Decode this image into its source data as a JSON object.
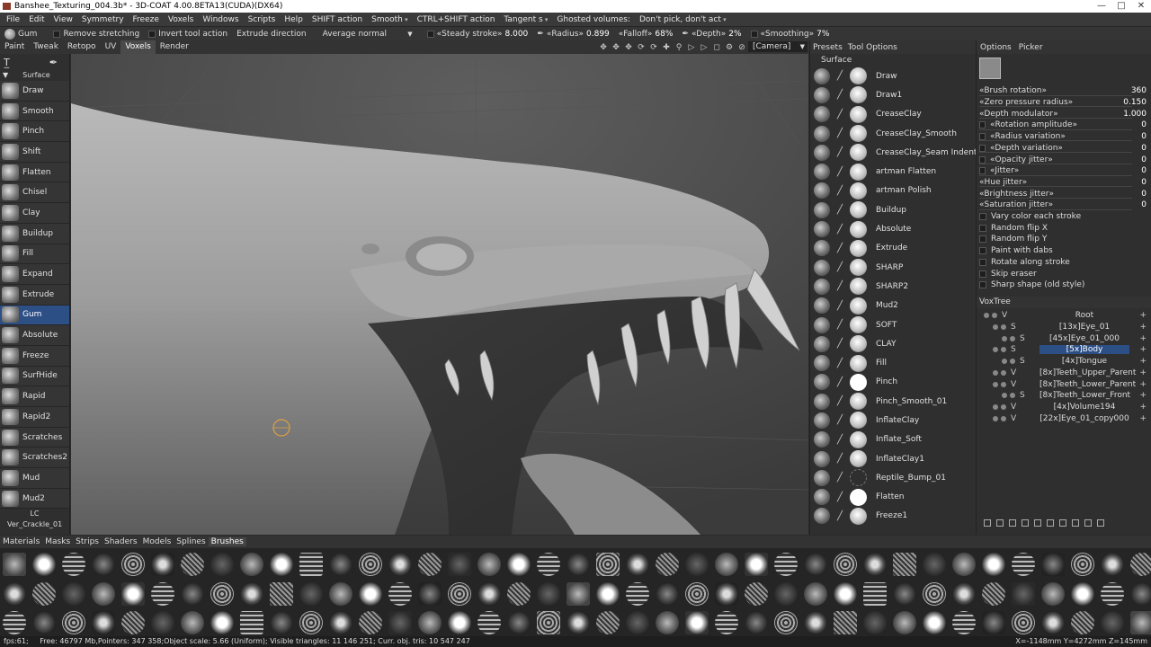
{
  "window": {
    "title": "Banshee_Texturing_004.3b* - 3D-COAT 4.00.8ETA13(CUDA)(DX64)",
    "minimize": "—",
    "maximize": "□",
    "close": "✕"
  },
  "menu": [
    {
      "label": "File",
      "dd": false
    },
    {
      "label": "Edit",
      "dd": false
    },
    {
      "label": "View",
      "dd": false
    },
    {
      "label": "Symmetry",
      "dd": false
    },
    {
      "label": "Freeze",
      "dd": false
    },
    {
      "label": "Voxels",
      "dd": false
    },
    {
      "label": "Windows",
      "dd": false
    },
    {
      "label": "Scripts",
      "dd": false
    },
    {
      "label": "Help",
      "dd": false
    },
    {
      "label": "SHIFT action",
      "dd": false
    },
    {
      "label": "Smooth",
      "dd": true
    },
    {
      "label": "CTRL+SHIFT action",
      "dd": false
    },
    {
      "label": "Tangent s",
      "dd": true
    },
    {
      "label": "Ghosted volumes:",
      "dd": false
    },
    {
      "label": "Don't pick, don't act",
      "dd": true
    }
  ],
  "toolbar": {
    "tool_name": "Gum",
    "remove_stretching": "Remove stretching",
    "invert_tool_action": "Invert tool action",
    "extrude_direction": "Extrude direction",
    "average_normal": "Average normal",
    "steady_stroke_label": "«Steady stroke»",
    "steady_stroke_value": "8.000",
    "radius_label": "«Radius»",
    "radius_value": "0.899",
    "falloff_label": "«Falloff»",
    "falloff_value": "68%",
    "depth_label": "«Depth»",
    "depth_value": "2%",
    "smoothing_label": "«Smoothing»",
    "smoothing_value": "7%"
  },
  "room_tabs": [
    "Paint",
    "Tweak",
    "Retopo",
    "UV",
    "Voxels",
    "Render"
  ],
  "active_room": "Voxels",
  "camera": "[Camera]",
  "left_panel": {
    "section": "Surface",
    "tools": [
      "Draw",
      "Smooth",
      "Pinch",
      "Shift",
      "Flatten",
      "Chisel",
      "Clay",
      "Buildup",
      "Fill",
      "Expand",
      "Extrude",
      "Gum",
      "Absolute",
      "Freeze",
      "SurfHide",
      "Rapid",
      "Rapid2",
      "Scratches",
      "Scratches2",
      "Mud",
      "Mud2"
    ],
    "active_tool": "Gum",
    "footer_tab": "LC",
    "footer_preset": "Ver_Crackle_01"
  },
  "presets": {
    "tabs": [
      "Presets",
      "Tool Options"
    ],
    "section": "Surface",
    "items": [
      {
        "name": "Draw",
        "dot": "sphere"
      },
      {
        "name": "Draw1",
        "dot": "sphere"
      },
      {
        "name": "CreaseClay",
        "dot": "sphere"
      },
      {
        "name": "CreaseClay_Smooth",
        "dot": "sphere"
      },
      {
        "name": "CreaseClay_Seam Indent",
        "dot": "sphere"
      },
      {
        "name": "artman Flatten",
        "dot": "sphere"
      },
      {
        "name": "artman Polish",
        "dot": "sphere"
      },
      {
        "name": "Buildup",
        "dot": "sphere"
      },
      {
        "name": "Absolute",
        "dot": "sphere"
      },
      {
        "name": "Extrude",
        "dot": "sphere"
      },
      {
        "name": "SHARP",
        "dot": "sphere"
      },
      {
        "name": "SHARP2",
        "dot": "sphere"
      },
      {
        "name": "Mud2",
        "dot": "sphere"
      },
      {
        "name": "SOFT",
        "dot": "sphere"
      },
      {
        "name": "CLAY",
        "dot": "sphere"
      },
      {
        "name": "Fill",
        "dot": "sphere"
      },
      {
        "name": "Pinch",
        "dot": "white"
      },
      {
        "name": "Pinch_Smooth_01",
        "dot": "sphere"
      },
      {
        "name": "InflateClay",
        "dot": "sphere"
      },
      {
        "name": "Inflate_Soft",
        "dot": "sphere"
      },
      {
        "name": "InflateClay1",
        "dot": "sphere"
      },
      {
        "name": "Reptile_Bump_01",
        "dot": "none"
      },
      {
        "name": "Flatten",
        "dot": "white"
      },
      {
        "name": "Freeze1",
        "dot": "sphere"
      }
    ]
  },
  "options": {
    "tabs": [
      "Options",
      "Picker"
    ],
    "sliders": [
      {
        "label": "«Brush rotation»",
        "value": "360"
      },
      {
        "label": "«Zero pressure radius»",
        "value": "0.150"
      },
      {
        "label": "«Depth modulator»",
        "value": "1.000"
      },
      {
        "label": "«Rotation amplitude»",
        "value": "0"
      },
      {
        "label": "«Radius variation»",
        "value": "0"
      },
      {
        "label": "«Depth variation»",
        "value": "0"
      },
      {
        "label": "«Opacity jitter»",
        "value": "0"
      },
      {
        "label": "«Jitter»",
        "value": "0"
      },
      {
        "label": "«Hue jitter»",
        "value": "0"
      },
      {
        "label": "«Brightness jitter»",
        "value": "0"
      },
      {
        "label": "«Saturation jitter»",
        "value": "0"
      }
    ],
    "checkboxes": [
      "Vary color each stroke",
      "Random flip X",
      "Random flip Y",
      "Paint with dabs",
      "Rotate along stroke",
      "Skip eraser",
      "Sharp shape (old style)"
    ]
  },
  "voxtree": {
    "title": "VoxTree",
    "items": [
      {
        "type": "V",
        "name": "Root",
        "indent": 0,
        "selected": false
      },
      {
        "type": "S",
        "name": "[13x]Eye_01",
        "indent": 1,
        "selected": false
      },
      {
        "type": "S",
        "name": "[45x]Eye_01_000",
        "indent": 2,
        "selected": false
      },
      {
        "type": "S",
        "name": "[5x]Body",
        "indent": 1,
        "selected": true
      },
      {
        "type": "S",
        "name": "[4x]Tongue",
        "indent": 2,
        "selected": false
      },
      {
        "type": "V",
        "name": "[8x]Teeth_Upper_Parent",
        "indent": 1,
        "selected": false
      },
      {
        "type": "V",
        "name": "[8x]Teeth_Lower_Parent",
        "indent": 1,
        "selected": false
      },
      {
        "type": "S",
        "name": "[8x]Teeth_Lower_Front",
        "indent": 2,
        "selected": false
      },
      {
        "type": "V",
        "name": "[4x]Volume194",
        "indent": 1,
        "selected": false
      },
      {
        "type": "V",
        "name": "[22x]Eye_01_copy000",
        "indent": 1,
        "selected": false
      }
    ]
  },
  "bottom_tabs": [
    "Materials",
    "Masks",
    "Strips",
    "Shaders",
    "Models",
    "Splines",
    "Brushes"
  ],
  "active_bottom_tab": "Brushes",
  "status": {
    "fps_label": "fps:61;",
    "info": "Free: 46797 Mb,Pointers: 347 358;Object scale: 5.66 (Uniform); Visible triangles: 11 146 251; Curr. obj. tris: 10 547 247",
    "coords": "X=-1148mm Y=4272mm Z=145mm"
  },
  "colors": {
    "accent": "#2c4f86",
    "panel": "#2f2f2f",
    "viewport": "#464646"
  }
}
